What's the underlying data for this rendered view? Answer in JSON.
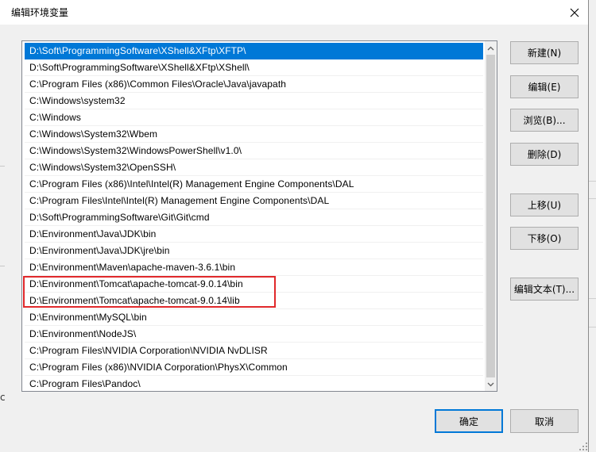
{
  "window": {
    "title": "编辑环境变量"
  },
  "path_list": {
    "entries": [
      "D:\\Soft\\ProgrammingSoftware\\XShell&XFtp\\XFTP\\",
      "D:\\Soft\\ProgrammingSoftware\\XShell&XFtp\\XShell\\",
      "C:\\Program Files (x86)\\Common Files\\Oracle\\Java\\javapath",
      "C:\\Windows\\system32",
      "C:\\Windows",
      "C:\\Windows\\System32\\Wbem",
      "C:\\Windows\\System32\\WindowsPowerShell\\v1.0\\",
      "C:\\Windows\\System32\\OpenSSH\\",
      "C:\\Program Files (x86)\\Intel\\Intel(R) Management Engine Components\\DAL",
      "C:\\Program Files\\Intel\\Intel(R) Management Engine Components\\DAL",
      "D:\\Soft\\ProgrammingSoftware\\Git\\Git\\cmd",
      "D:\\Environment\\Java\\JDK\\bin",
      "D:\\Environment\\Java\\JDK\\jre\\bin",
      "D:\\Environment\\Maven\\apache-maven-3.6.1\\bin",
      "D:\\Environment\\Tomcat\\apache-tomcat-9.0.14\\bin",
      "D:\\Environment\\Tomcat\\apache-tomcat-9.0.14\\lib",
      "D:\\Environment\\MySQL\\bin",
      "D:\\Environment\\NodeJS\\",
      "C:\\Program Files\\NVIDIA Corporation\\NVIDIA NvDLISR",
      "C:\\Program Files (x86)\\NVIDIA Corporation\\PhysX\\Common",
      "C:\\Program Files\\Pandoc\\"
    ],
    "selected_index": 0
  },
  "buttons": {
    "new": "新建(N)",
    "edit": "编辑(E)",
    "browse": "浏览(B)...",
    "delete": "删除(D)",
    "move_up": "上移(U)",
    "move_down": "下移(O)",
    "edit_text": "编辑文本(T)...",
    "ok": "确定",
    "cancel": "取消"
  },
  "background": {
    "partial_char": "c"
  },
  "icons": {
    "close": "close-icon",
    "scroll_up": "chevron-up-icon",
    "scroll_down": "chevron-down-icon",
    "resize": "resize-grip-icon"
  },
  "colors": {
    "selection": "#0078d7",
    "highlight_box": "#e0282b",
    "default_button_border": "#0078d7"
  }
}
